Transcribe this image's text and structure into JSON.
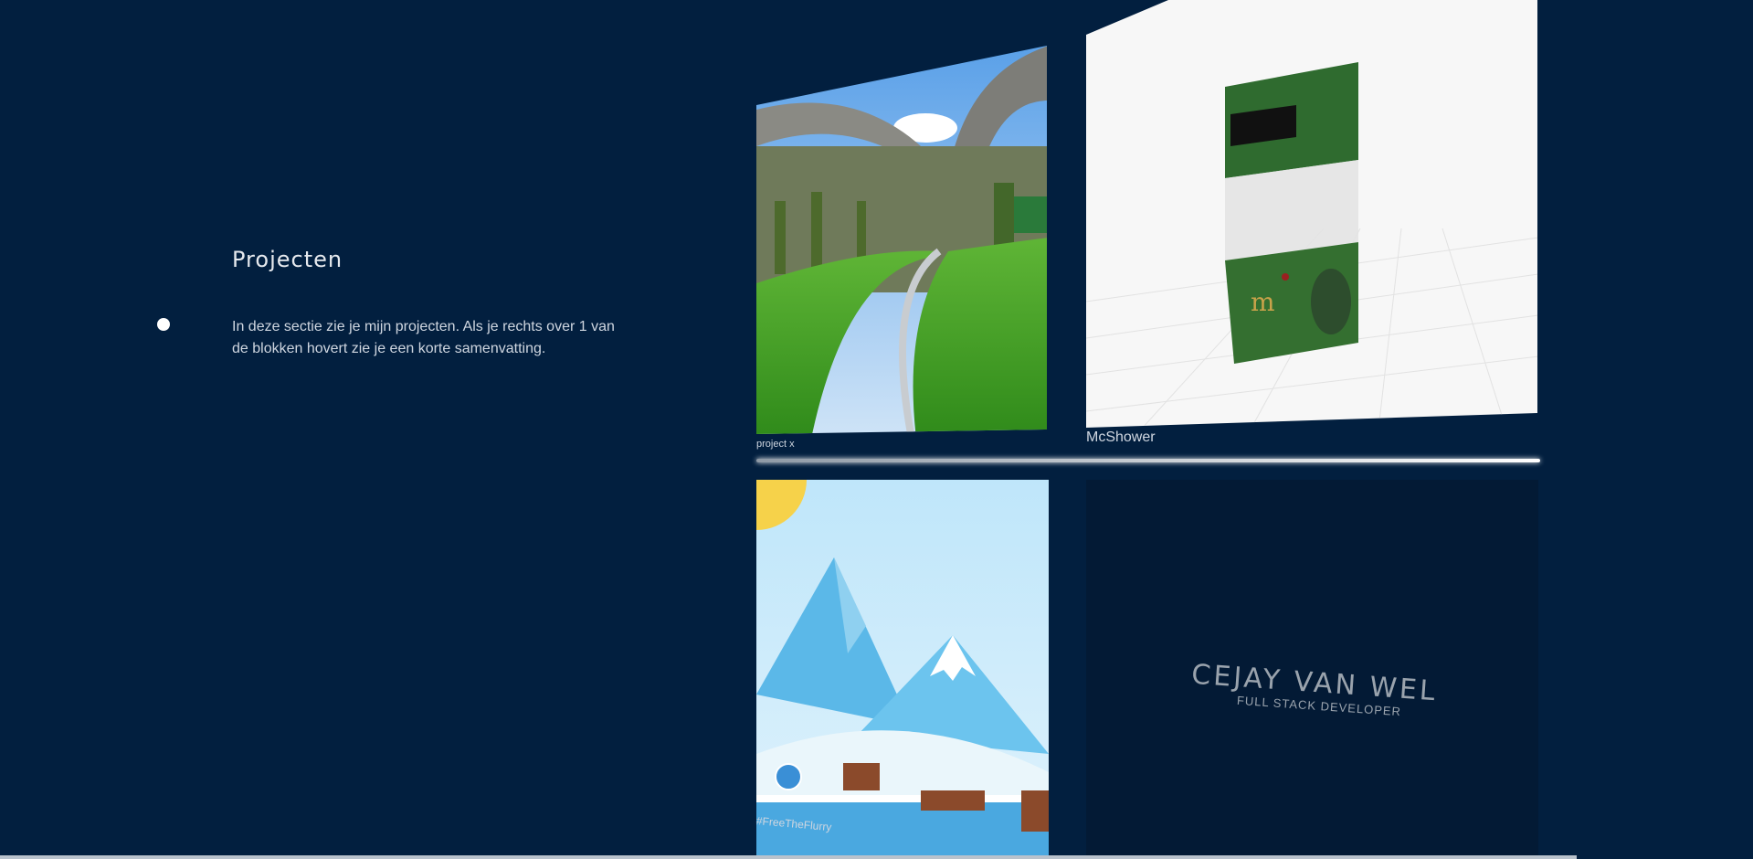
{
  "section": {
    "title": "Projecten",
    "description": "In deze sectie zie je mijn projecten. Als je rechts over 1 van de blokken hovert zie je een korte samenvatting."
  },
  "projects": [
    {
      "label": "project x",
      "image": "green-highway-image"
    },
    {
      "label": "McShower",
      "image": "mcshower-3d-model-image"
    },
    {
      "label": "#FreeTheFlurry",
      "image": "snow-game-image"
    },
    {
      "logo_name": "CEJAY VAN WEL",
      "logo_subtitle": "FULL STACK DEVELOPER"
    }
  ],
  "colors": {
    "background": "#021f3f",
    "accent": "#ffffff"
  }
}
